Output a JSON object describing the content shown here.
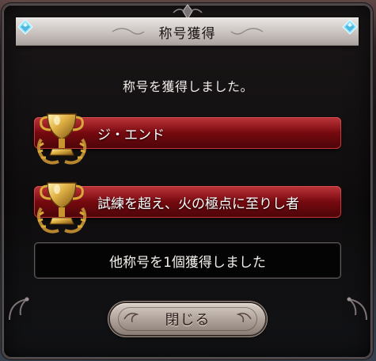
{
  "dialog": {
    "title": "称号獲得",
    "message": "称号を獲得しました。"
  },
  "awards": [
    {
      "label": "ジ・エンド",
      "icon": "gold-trophy-icon"
    },
    {
      "label": "試練を超え、火の極点に至りし者",
      "icon": "gold-trophy-icon"
    }
  ],
  "summary": {
    "text": "他称号を1個獲得しました"
  },
  "actions": {
    "close_label": "閉じる"
  },
  "colors": {
    "accent_red": "#8e0e14",
    "title_silver": "#c9c2be",
    "gem_cyan": "#8fe6ff",
    "trophy_gold": "#d9a93a"
  }
}
